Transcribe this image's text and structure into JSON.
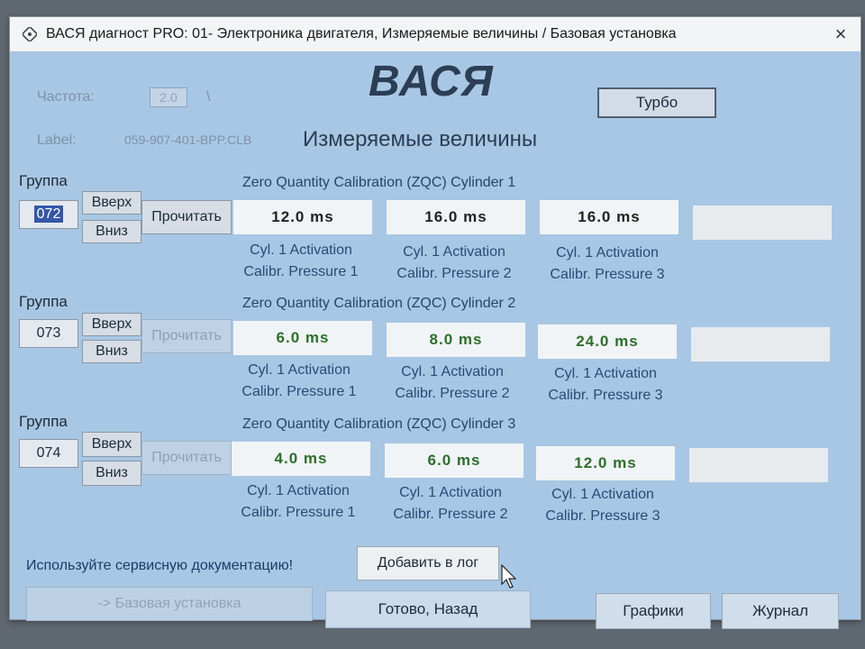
{
  "window": {
    "title": "ВАСЯ диагност PRO: 01- Электроника двигателя,  Измеряемые величины / Базовая установка",
    "close": "×"
  },
  "header": {
    "freq_label": "Частота:",
    "freq_value": "2.0",
    "freq_sep": "\\",
    "label_label": "Label:",
    "label_value": "059-907-401-BPP.CLB",
    "logo": "ВАСЯ",
    "subtitle": "Измеряемые величины",
    "turbo": "Турбо"
  },
  "groups": [
    {
      "label": "Группа",
      "number": "072",
      "up": "Вверх",
      "down": "Вниз",
      "read": "Прочитать",
      "title": "Zero Quantity Calibration (ZQC) Cylinder 1",
      "values": [
        "12.0 ms",
        "16.0 ms",
        "16.0 ms",
        ""
      ],
      "captions": [
        {
          "l1": "Cyl. 1 Activation",
          "l2": "Calibr. Pressure 1"
        },
        {
          "l1": "Cyl. 1 Activation",
          "l2": "Calibr. Pressure 2"
        },
        {
          "l1": "Cyl. 1 Activation",
          "l2": "Calibr. Pressure 3"
        }
      ]
    },
    {
      "label": "Группа",
      "number": "073",
      "up": "Вверх",
      "down": "Вниз",
      "read": "Прочитать",
      "title": "Zero Quantity Calibration (ZQC) Cylinder 2",
      "values": [
        "6.0 ms",
        "8.0 ms",
        "24.0 ms",
        ""
      ],
      "captions": [
        {
          "l1": "Cyl. 1 Activation",
          "l2": "Calibr. Pressure 1"
        },
        {
          "l1": "Cyl. 1 Activation",
          "l2": "Calibr. Pressure 2"
        },
        {
          "l1": "Cyl. 1 Activation",
          "l2": "Calibr. Pressure 3"
        }
      ]
    },
    {
      "label": "Группа",
      "number": "074",
      "up": "Вверх",
      "down": "Вниз",
      "read": "Прочитать",
      "title": "Zero Quantity Calibration (ZQC) Cylinder 3",
      "values": [
        "4.0 ms",
        "6.0 ms",
        "12.0 ms",
        ""
      ],
      "captions": [
        {
          "l1": "Cyl. 1 Activation",
          "l2": "Calibr. Pressure 1"
        },
        {
          "l1": "Cyl. 1 Activation",
          "l2": "Calibr. Pressure 2"
        },
        {
          "l1": "Cyl. 1 Activation",
          "l2": "Calibr. Pressure 3"
        }
      ]
    }
  ],
  "footer": {
    "hint": "Используйте сервисную документацию!",
    "add_log": "Добавить в лог",
    "basic_settings": "-> Базовая установка",
    "done": "Готово, Назад",
    "graphs": "Графики",
    "journal": "Журнал"
  },
  "colors": {
    "panel": "#a8c7e4",
    "value_green": "#2c6f2c",
    "logo": "#2c3e55"
  }
}
